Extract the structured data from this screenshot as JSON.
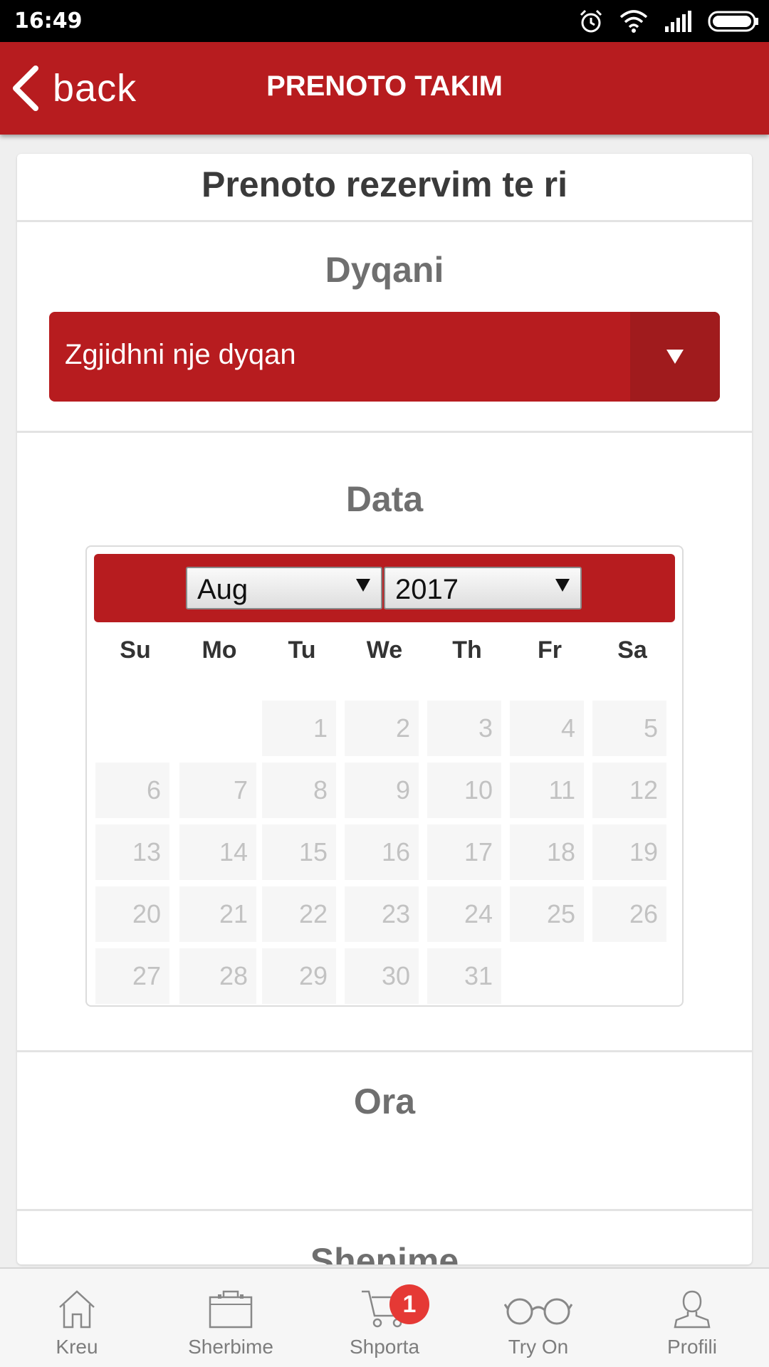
{
  "status_bar": {
    "time": "16:49",
    "icons": [
      "alarm-icon",
      "wifi-icon",
      "signal-icon",
      "battery-icon"
    ]
  },
  "header": {
    "back_label": "back",
    "title": "PRENOTO TAKIM"
  },
  "card": {
    "title": "Prenoto rezervim te ri",
    "store": {
      "label": "Dyqani",
      "placeholder": "Zgjidhni nje dyqan"
    },
    "date": {
      "label": "Data",
      "month": "Aug",
      "year": "2017",
      "weekdays": [
        "Su",
        "Mo",
        "Tu",
        "We",
        "Th",
        "Fr",
        "Sa"
      ],
      "first_weekday_index": 2,
      "days_in_month": 31,
      "days": [
        "1",
        "2",
        "3",
        "4",
        "5",
        "6",
        "7",
        "8",
        "9",
        "10",
        "11",
        "12",
        "13",
        "14",
        "15",
        "16",
        "17",
        "18",
        "19",
        "20",
        "21",
        "22",
        "23",
        "24",
        "25",
        "26",
        "27",
        "28",
        "29",
        "30",
        "31"
      ]
    },
    "time": {
      "label": "Ora"
    },
    "notes": {
      "label": "Shenime"
    }
  },
  "bottom_nav": {
    "items": [
      {
        "label": "Kreu",
        "icon": "home-icon"
      },
      {
        "label": "Sherbime",
        "icon": "briefcase-icon"
      },
      {
        "label": "Shporta",
        "icon": "cart-icon",
        "badge": "1"
      },
      {
        "label": "Try On",
        "icon": "glasses-icon"
      },
      {
        "label": "Profili",
        "icon": "user-icon"
      }
    ]
  },
  "colors": {
    "brand_red": "#b71c1f",
    "dark_red": "#a01b1d",
    "badge_red": "#e53935",
    "disabled_day_text": "#c2c2c2"
  }
}
